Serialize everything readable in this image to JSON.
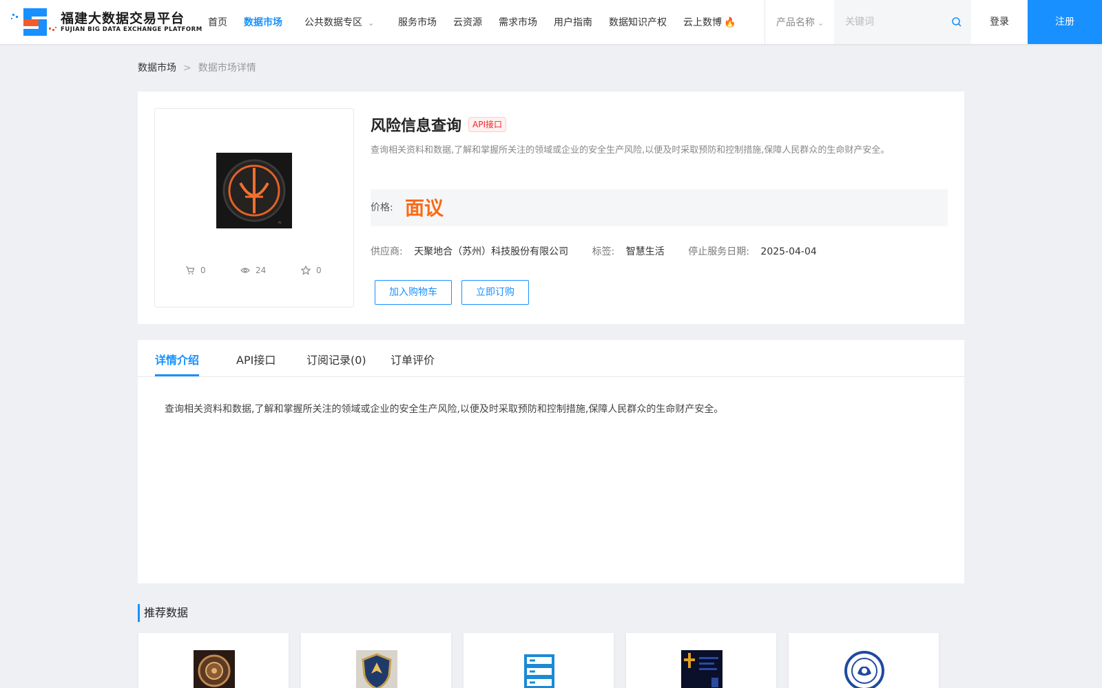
{
  "header": {
    "logo": {
      "title_cn": "福建大数据交易平台",
      "title_en": "FUJIAN BIG DATA EXCHANGE  PLATFORM"
    },
    "nav": [
      {
        "label": "首页",
        "active": false
      },
      {
        "label": "数据市场",
        "active": true
      },
      {
        "label": "公共数据专区",
        "active": false,
        "has_dropdown": true
      },
      {
        "label": "服务市场",
        "active": false
      },
      {
        "label": "云资源",
        "active": false
      },
      {
        "label": "需求市场",
        "active": false
      },
      {
        "label": "用户指南",
        "active": false
      },
      {
        "label": "数据知识产权",
        "active": false
      },
      {
        "label": "云上数博",
        "active": false,
        "icon": "fire-icon"
      }
    ],
    "search": {
      "type_label": "产品名称",
      "placeholder": "关键词",
      "value": ""
    },
    "login_label": "登录",
    "register_label": "注册"
  },
  "breadcrumb": {
    "root": "数据市场",
    "separator": ">",
    "current": "数据市场详情"
  },
  "product": {
    "title": "风险信息查询",
    "badge": "API接口",
    "description": "查询相关资料和数据,了解和掌握所关注的领域或企业的安全生产风险,以便及时采取预防和控制措施,保障人民群众的生命财产安全。",
    "price_label": "价格:",
    "price_value": "面议",
    "supplier_label": "供应商:",
    "supplier_value": "天聚地合（苏州）科技股份有限公司",
    "tag_label": "标签:",
    "tag_value": "智慧生活",
    "stop_date_label": "停止服务日期:",
    "stop_date_value": "2025-04-04",
    "stats": {
      "cart": "0",
      "views": "24",
      "favorites": "0"
    },
    "add_cart_label": "加入购物车",
    "buy_label": "立即订购"
  },
  "detail": {
    "tabs": [
      {
        "label": "详情介绍",
        "active": true
      },
      {
        "label": "API接口",
        "active": false
      },
      {
        "label": "订阅记录(0)",
        "active": false
      },
      {
        "label": "订单评价",
        "active": false
      }
    ],
    "content": "查询相关资料和数据,了解和掌握所关注的领域或企业的安全生产风险,以便及时采取预防和控制措施,保障人民群众的生命财产安全。"
  },
  "recommend": {
    "title": "推荐数据",
    "items": [
      {
        "icon": "bronze-emblem-icon"
      },
      {
        "icon": "shield-emblem-icon"
      },
      {
        "icon": "server-icon"
      },
      {
        "icon": "dark-logo-icon"
      },
      {
        "icon": "seal-emblem-icon"
      }
    ]
  },
  "colors": {
    "primary": "#1890ff",
    "price": "#fa6a15",
    "badge": "#f5222d"
  }
}
